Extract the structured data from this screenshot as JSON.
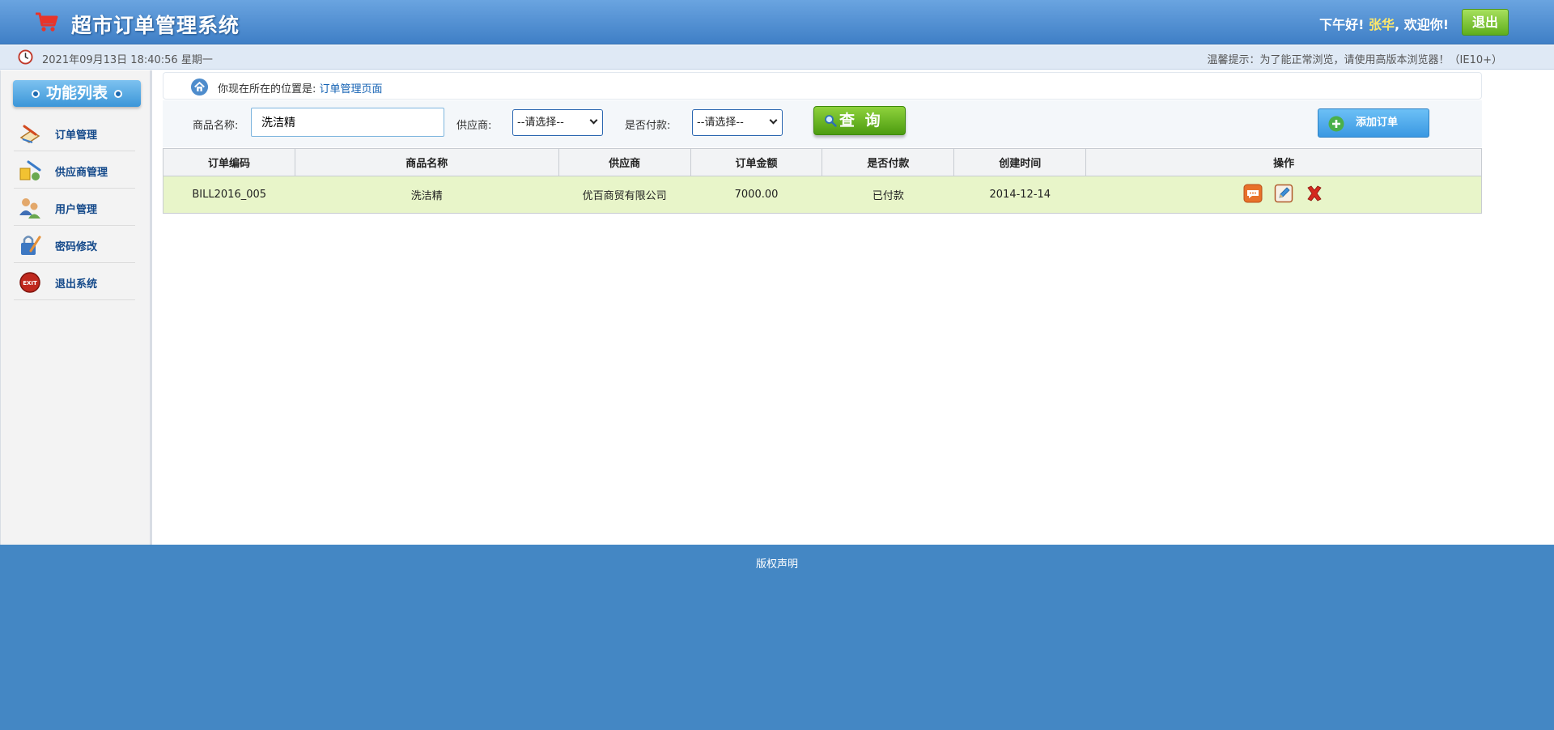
{
  "header": {
    "app_title": "超市订单管理系统",
    "greeting_prefix": "下午好!",
    "username": "张华",
    "greeting_suffix": ", 欢迎你!",
    "logout_label": "退出"
  },
  "subbar": {
    "datetime": "2021年09月13日 18:40:56 星期一",
    "tip": "温馨提示：为了能正常浏览，请使用高版本浏览器！（IE10+）"
  },
  "sidebar": {
    "title": "功能列表",
    "items": [
      {
        "label": "订单管理",
        "icon": "order-icon"
      },
      {
        "label": "供应商管理",
        "icon": "supplier-icon"
      },
      {
        "label": "用户管理",
        "icon": "users-icon"
      },
      {
        "label": "密码修改",
        "icon": "password-icon"
      },
      {
        "label": "退出系统",
        "icon": "exit-icon"
      }
    ]
  },
  "breadcrumb": {
    "prefix": "你现在所在的位置是:",
    "current": "订单管理页面"
  },
  "search": {
    "product_label": "商品名称:",
    "product_value": "洗洁精",
    "provider_label": "供应商:",
    "provider_selected": "--请选择--",
    "paid_label": "是否付款:",
    "paid_selected": "--请选择--",
    "query_label": "查 询",
    "add_label": "添加订单"
  },
  "table": {
    "columns": [
      "订单编码",
      "商品名称",
      "供应商",
      "订单金额",
      "是否付款",
      "创建时间",
      "操作"
    ],
    "rows": [
      {
        "code": "BILL2016_005",
        "product": "洗洁精",
        "provider": "优百商贸有限公司",
        "amount": "7000.00",
        "paid": "已付款",
        "created": "2014-12-14"
      }
    ]
  },
  "footer": {
    "text": "版权声明"
  },
  "colors": {
    "header_blue": "#4a8ad0",
    "logout_green": "#6bb82a",
    "row_highlight": "#e8f5c9",
    "footer_blue": "#4487c4"
  }
}
